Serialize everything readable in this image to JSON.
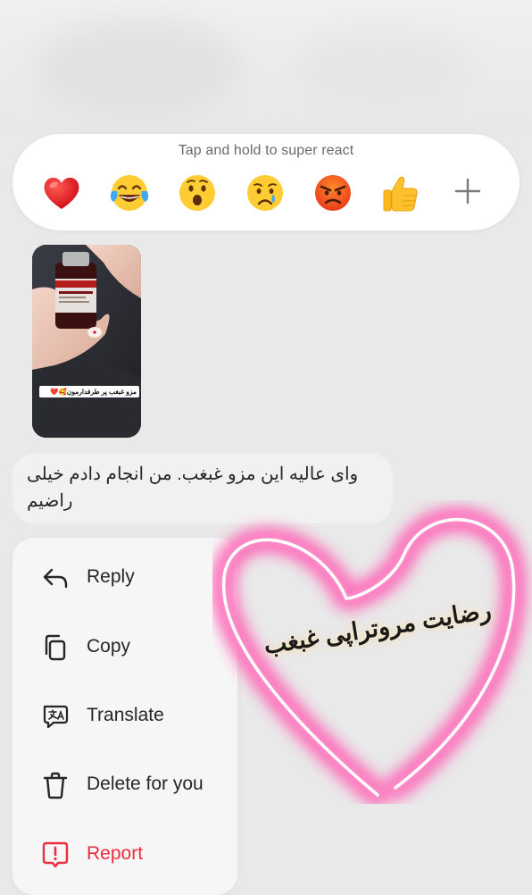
{
  "reaction_bar": {
    "hint": "Tap and hold to super react",
    "reactions": [
      "red-heart",
      "face-with-tears-of-joy",
      "face-with-open-mouth",
      "crying-face",
      "angry-face",
      "thumbs-up"
    ],
    "more_icon": "plus-icon"
  },
  "media": {
    "caption": "مزو غبغب پر طرفدارمون🥰❤️"
  },
  "message": {
    "text": "وای عالیه این مزو غبغب. من انجام دادم خیلی راضیم"
  },
  "menu": {
    "items": [
      {
        "label": "Reply",
        "icon": "reply-arrow-icon"
      },
      {
        "label": "Copy",
        "icon": "copy-icon"
      },
      {
        "label": "Translate",
        "icon": "translate-icon"
      },
      {
        "label": "Delete for you",
        "icon": "trash-icon"
      },
      {
        "label": "Report",
        "icon": "report-icon"
      }
    ]
  },
  "sticker": {
    "text": "رضایت مروتراپی غبغب"
  },
  "colors": {
    "danger": "#ed2c3f",
    "neon_pink": "#ff5fb4",
    "background": "#e9e9e9"
  }
}
